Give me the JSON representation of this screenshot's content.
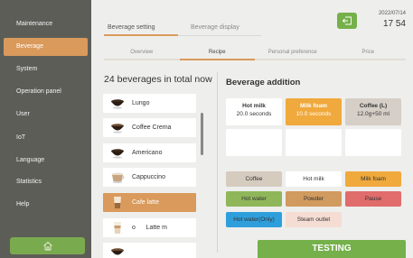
{
  "sidebar": {
    "items": [
      {
        "label": "Maintenance"
      },
      {
        "label": "Beverage"
      },
      {
        "label": "System"
      },
      {
        "label": "Operation panel"
      },
      {
        "label": "User"
      },
      {
        "label": "IoT"
      },
      {
        "label": "Language"
      },
      {
        "label": "Statistics"
      },
      {
        "label": "Help"
      }
    ],
    "active_item": "Beverage",
    "home_icon": "home-icon"
  },
  "header": {
    "main_tabs": [
      {
        "label": "Beverage setting"
      },
      {
        "label": "Beverage display"
      }
    ],
    "sub_tabs": [
      {
        "label": "Overview"
      },
      {
        "label": "Recipe"
      },
      {
        "label": "Personal preference"
      },
      {
        "label": "Price"
      }
    ],
    "date": "2022/07/14",
    "time": "17 54",
    "exit_icon": "exit-icon"
  },
  "beverage_list": {
    "title": "24 beverages in total now",
    "items": [
      {
        "name": "Lungo"
      },
      {
        "name": "Coffee Crema"
      },
      {
        "name": "Americano"
      },
      {
        "name": "Cappuccino"
      },
      {
        "name": "Cafe latte"
      },
      {
        "name": "o      Latte m"
      }
    ],
    "selected": "Cafe latte"
  },
  "addition": {
    "title": "Beverage addition",
    "slots": [
      {
        "name": "Hot milk",
        "value": "20.0 seconds"
      },
      {
        "name": "Milk foam",
        "value": "10.0 seconds"
      },
      {
        "name": "Coffee (L)",
        "value": "12.0g+50 ml"
      },
      {
        "name": "",
        "value": ""
      },
      {
        "name": "",
        "value": ""
      },
      {
        "name": "",
        "value": ""
      }
    ],
    "ingredients": [
      {
        "label": "Coffee"
      },
      {
        "label": "Hot milk"
      },
      {
        "label": "Milk foam"
      },
      {
        "label": "Hot water"
      },
      {
        "label": "Powder"
      },
      {
        "label": "Pause"
      },
      {
        "label": "Hot water(Only)"
      },
      {
        "label": "Steam outlet"
      }
    ],
    "testing_label": "TESTING"
  },
  "colors": {
    "accent": "#d99a5c",
    "green": "#75b04a",
    "sidebar_bg": "#5d5d58"
  }
}
